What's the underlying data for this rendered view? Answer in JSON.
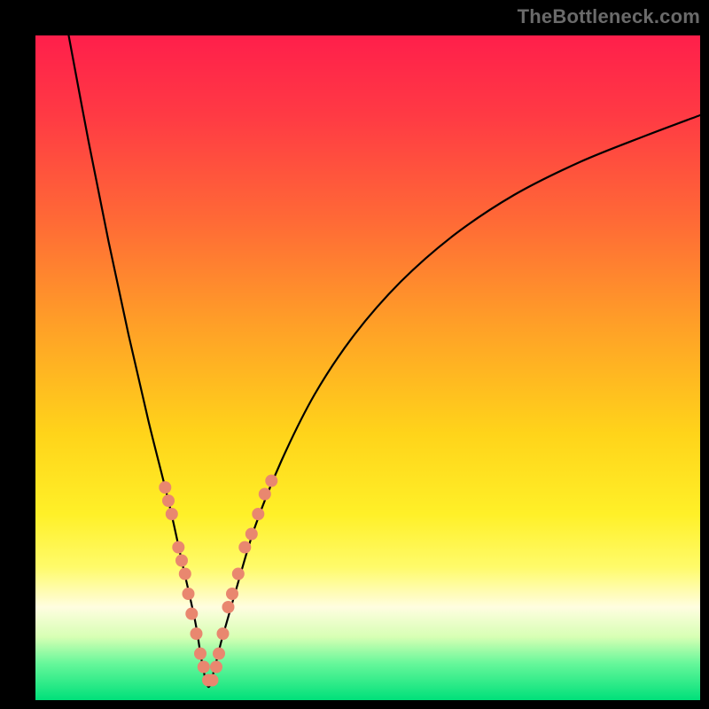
{
  "watermark": {
    "text": "TheBottleneck.com"
  },
  "gradient": {
    "stops": [
      {
        "offset": 0.0,
        "color": "#ff1f4b"
      },
      {
        "offset": 0.12,
        "color": "#ff3a44"
      },
      {
        "offset": 0.28,
        "color": "#ff6a36"
      },
      {
        "offset": 0.44,
        "color": "#ffa127"
      },
      {
        "offset": 0.6,
        "color": "#ffd41a"
      },
      {
        "offset": 0.72,
        "color": "#fff028"
      },
      {
        "offset": 0.8,
        "color": "#fffb6a"
      },
      {
        "offset": 0.86,
        "color": "#fffde0"
      },
      {
        "offset": 0.905,
        "color": "#d7ffb4"
      },
      {
        "offset": 0.945,
        "color": "#66f79a"
      },
      {
        "offset": 1.0,
        "color": "#00e07a"
      }
    ]
  },
  "chart_data": {
    "type": "line",
    "title": "",
    "xlabel": "",
    "ylabel": "",
    "xlim": [
      0,
      100
    ],
    "ylim": [
      0,
      100
    ],
    "grid": false,
    "legend": false,
    "note": "V-shaped bottleneck curve; minimum near x≈26. Values are approximate, read from pixel positions.",
    "series": [
      {
        "name": "curve",
        "color": "#000000",
        "x": [
          5,
          8,
          11,
          14,
          17,
          20,
          22,
          24,
          25,
          26,
          27,
          28,
          30,
          33,
          37,
          42,
          48,
          55,
          63,
          72,
          82,
          92,
          100
        ],
        "y": [
          100,
          84,
          69,
          55,
          42,
          30,
          21,
          12,
          6,
          2,
          5,
          9,
          16,
          26,
          36,
          46,
          55,
          63,
          70,
          76,
          81,
          85,
          88
        ]
      }
    ],
    "markers": {
      "name": "dots",
      "color": "#e9876f",
      "points": [
        {
          "x": 19.5,
          "y": 32
        },
        {
          "x": 20.0,
          "y": 30
        },
        {
          "x": 20.5,
          "y": 28
        },
        {
          "x": 21.5,
          "y": 23
        },
        {
          "x": 22.0,
          "y": 21
        },
        {
          "x": 22.5,
          "y": 19
        },
        {
          "x": 23.0,
          "y": 16
        },
        {
          "x": 23.5,
          "y": 13
        },
        {
          "x": 24.2,
          "y": 10
        },
        {
          "x": 24.8,
          "y": 7
        },
        {
          "x": 25.3,
          "y": 5
        },
        {
          "x": 26.0,
          "y": 3
        },
        {
          "x": 26.6,
          "y": 3
        },
        {
          "x": 27.2,
          "y": 5
        },
        {
          "x": 27.6,
          "y": 7
        },
        {
          "x": 28.2,
          "y": 10
        },
        {
          "x": 29.0,
          "y": 14
        },
        {
          "x": 29.6,
          "y": 16
        },
        {
          "x": 30.5,
          "y": 19
        },
        {
          "x": 31.5,
          "y": 23
        },
        {
          "x": 32.5,
          "y": 25
        },
        {
          "x": 33.5,
          "y": 28
        },
        {
          "x": 34.5,
          "y": 31
        },
        {
          "x": 35.5,
          "y": 33
        }
      ]
    }
  }
}
